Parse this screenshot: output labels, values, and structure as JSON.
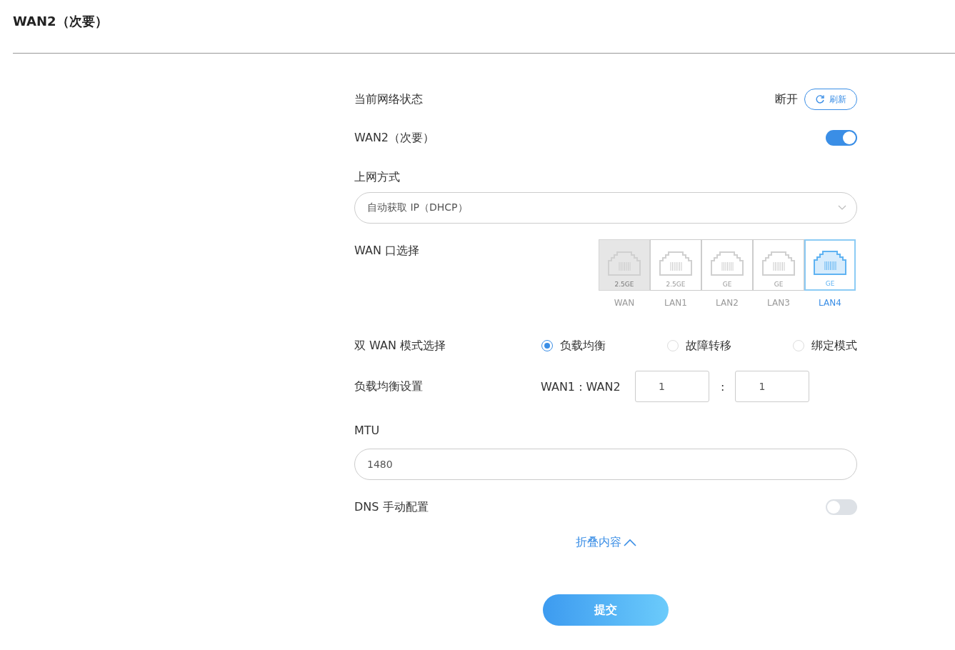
{
  "header": {
    "title": "WAN2（次要）"
  },
  "status": {
    "label": "当前网络状态",
    "value": "断开",
    "refresh_button": "刷新"
  },
  "wan2": {
    "label": "WAN2（次要）",
    "on": true
  },
  "access_mode": {
    "label": "上网方式",
    "value": "自动获取 IP（DHCP）"
  },
  "wan_port": {
    "label": "WAN 口选择",
    "ports": [
      {
        "speed": "2.5GE",
        "name": "WAN",
        "selected": false,
        "disabled": true
      },
      {
        "speed": "2.5GE",
        "name": "LAN1",
        "selected": false,
        "disabled": false
      },
      {
        "speed": "GE",
        "name": "LAN2",
        "selected": false,
        "disabled": false
      },
      {
        "speed": "GE",
        "name": "LAN3",
        "selected": false,
        "disabled": false
      },
      {
        "speed": "GE",
        "name": "LAN4",
        "selected": true,
        "disabled": false
      }
    ]
  },
  "dual_wan": {
    "label": "双 WAN 模式选择",
    "options": [
      {
        "label": "负载均衡",
        "selected": true
      },
      {
        "label": "故障转移",
        "selected": false
      },
      {
        "label": "绑定模式",
        "selected": false
      }
    ]
  },
  "load_balance": {
    "label": "负载均衡设置",
    "ratio_label": "WAN1 : WAN2",
    "wan1": "1",
    "separator": ":",
    "wan2": "1"
  },
  "mtu": {
    "label": "MTU",
    "value": "1480"
  },
  "dns": {
    "label": "DNS 手动配置",
    "on": false
  },
  "collapse_link": "折叠内容",
  "submit_button": "提交"
}
